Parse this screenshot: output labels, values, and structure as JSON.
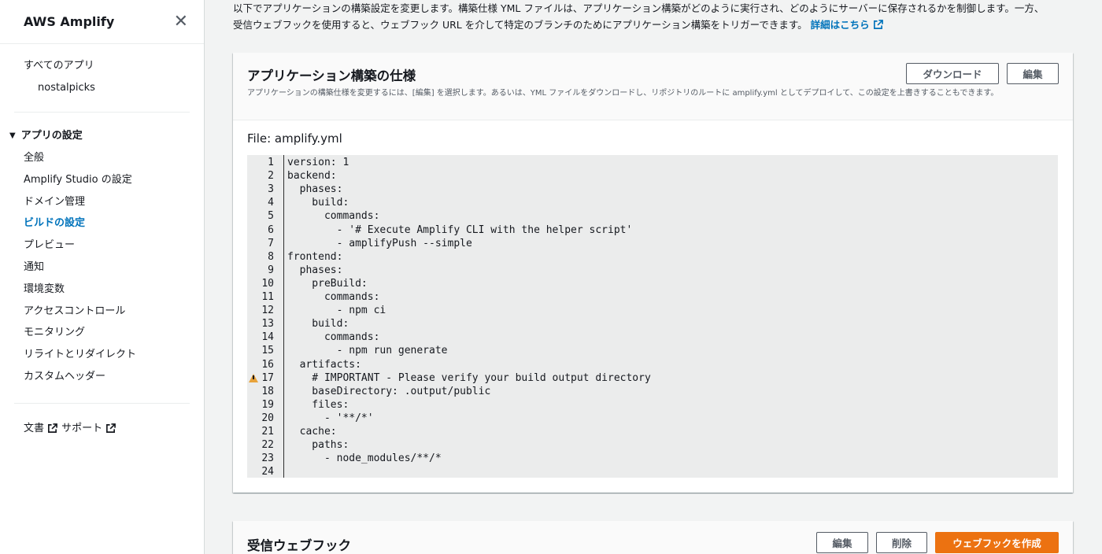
{
  "sidebar": {
    "title": "AWS Amplify",
    "all_apps": "すべてのアプリ",
    "app_name": "nostalpicks",
    "group_title": "アプリの設定",
    "items": [
      {
        "label": "全般",
        "active": false
      },
      {
        "label": "Amplify Studio の設定",
        "active": false
      },
      {
        "label": "ドメイン管理",
        "active": false
      },
      {
        "label": "ビルドの設定",
        "active": true
      },
      {
        "label": "プレビュー",
        "active": false
      },
      {
        "label": "通知",
        "active": false
      },
      {
        "label": "環境変数",
        "active": false
      },
      {
        "label": "アクセスコントロール",
        "active": false
      },
      {
        "label": "モニタリング",
        "active": false
      },
      {
        "label": "リライトとリダイレクト",
        "active": false
      },
      {
        "label": "カスタムヘッダー",
        "active": false
      }
    ],
    "docs_label": "文書",
    "support_label": "サポート"
  },
  "intro": {
    "line1": "以下でアプリケーションの構築設定を変更します。構築仕様 YML ファイルは、アプリケーション構築がどのように実行され、どのようにサーバーに保存されるかを制御します。一方、",
    "line2": "受信ウェブフックを使用すると、ウェブフック URL を介して特定のブランチのためにアプリケーション構築をトリガーできます。",
    "link": "詳細はこちら"
  },
  "build_spec": {
    "title": "アプリケーション構築の仕様",
    "description": "アプリケーションの構築仕様を変更するには、[編集] を選択します。あるいは、YML ファイルをダウンロードし、リポジトリのルートに amplify.yml としてデプロイして、この設定を上書きすることもできます。",
    "download_label": "ダウンロード",
    "edit_label": "編集",
    "file_label": "File: amplify.yml",
    "code_lines": [
      "version: 1",
      "backend:",
      "  phases:",
      "    build:",
      "      commands:",
      "        - '# Execute Amplify CLI with the helper script'",
      "        - amplifyPush --simple",
      "frontend:",
      "  phases:",
      "    preBuild:",
      "      commands:",
      "        - npm ci",
      "    build:",
      "      commands:",
      "        - npm run generate",
      "  artifacts:",
      "    # IMPORTANT - Please verify your build output directory",
      "    baseDirectory: .output/public",
      "    files:",
      "      - '**/*'",
      "  cache:",
      "    paths:",
      "      - node_modules/**/*",
      ""
    ],
    "warning_line": 17
  },
  "webhooks": {
    "title": "受信ウェブフック",
    "edit_label": "編集",
    "delete_label": "削除",
    "create_label": "ウェブフックを作成"
  },
  "colors": {
    "accent": "#0073bb",
    "primary_button": "#ec7211",
    "warning": "#e8a33b"
  }
}
